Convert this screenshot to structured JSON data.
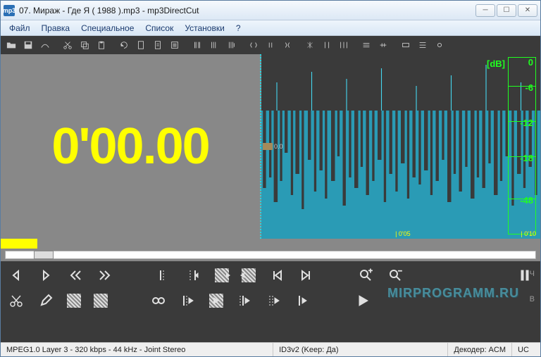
{
  "window": {
    "title": "07. Мираж - Где Я ( 1988 ).mp3 - mp3DirectCut",
    "app_icon_text": "mp3"
  },
  "menu": {
    "file": "Файл",
    "edit": "Правка",
    "special": "Специальное",
    "list": "Список",
    "settings": "Установки",
    "help": "?"
  },
  "time_display": "0'00.00",
  "cursor_label": "0.0",
  "wave_time_labels": {
    "t1": "0'05",
    "t2": "0'10"
  },
  "db": {
    "label": "[dB]",
    "v0": "0",
    "v1": "-6",
    "v2": "-12",
    "v3": "-18",
    "v4": "-48"
  },
  "side": {
    "ch": "Ч",
    "b": "В"
  },
  "watermark": "MIRPROGRAMM.RU",
  "status": {
    "format": "MPEG1.0 Layer 3 - 320 kbps - 44 kHz - Joint Stereo",
    "id3": "ID3v2 (Keep: Да)",
    "decoder": "Декодер: ACM",
    "uc": "UC"
  }
}
